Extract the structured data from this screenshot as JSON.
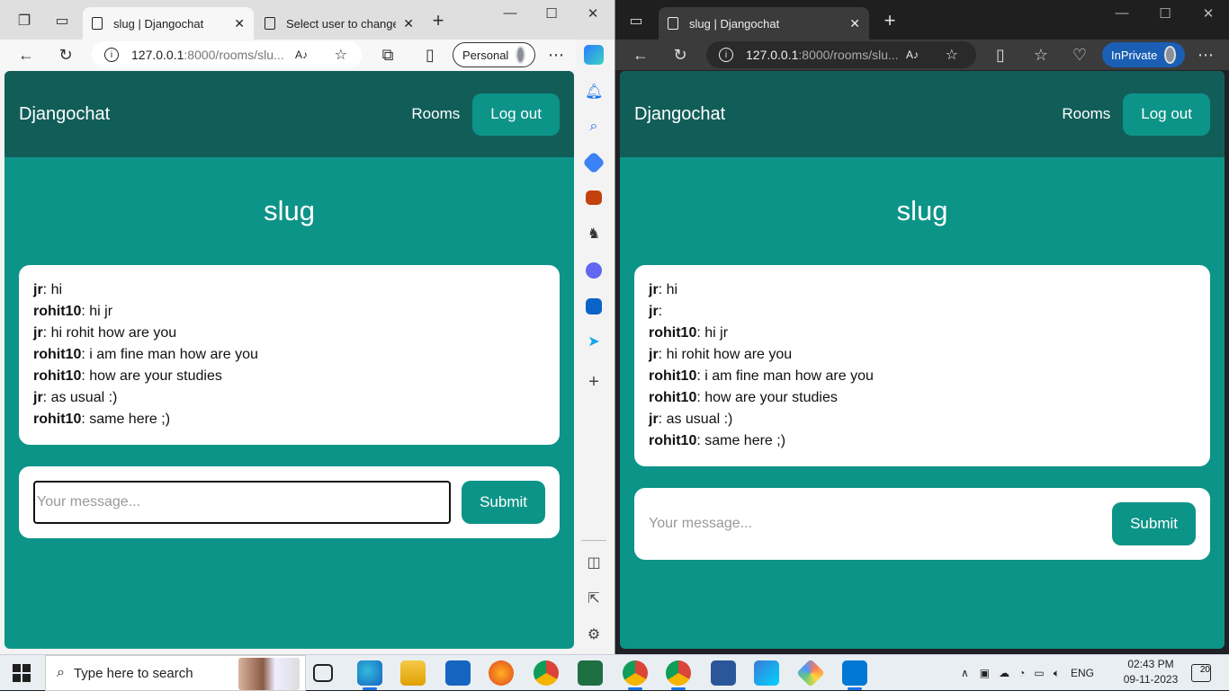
{
  "left_browser": {
    "tabs": [
      {
        "title": "slug | Djangochat",
        "close": "✕"
      },
      {
        "title": "Select user to change | Django site admin",
        "close": "✕"
      }
    ],
    "url_host": "127.0.0.1",
    "url_path": ":8000/rooms/slu...",
    "profile_label": "Personal"
  },
  "right_browser": {
    "tabs": [
      {
        "title": "slug | Djangochat",
        "close": "✕"
      }
    ],
    "url_host": "127.0.0.1",
    "url_path": ":8000/rooms/slu...",
    "profile_label": "InPrivate"
  },
  "left_app": {
    "brand": "Djangochat",
    "nav_rooms": "Rooms",
    "nav_logout": "Log out",
    "room_name": "slug",
    "messages": [
      {
        "user": "jr",
        "text": ": hi"
      },
      {
        "user": "rohit10",
        "text": ": hi jr"
      },
      {
        "user": "jr",
        "text": ": hi rohit how are you"
      },
      {
        "user": "rohit10",
        "text": ": i am fine man how are you"
      },
      {
        "user": "rohit10",
        "text": ": how are your studies"
      },
      {
        "user": "jr",
        "text": ": as usual :)"
      },
      {
        "user": "rohit10",
        "text": ": same here ;)"
      }
    ],
    "input_placeholder": "Your message...",
    "submit_label": "Submit"
  },
  "right_app": {
    "brand": "Djangochat",
    "nav_rooms": "Rooms",
    "nav_logout": "Log out",
    "room_name": "slug",
    "messages": [
      {
        "user": "jr",
        "text": ": hi"
      },
      {
        "user": "jr",
        "text": ":"
      },
      {
        "user": "rohit10",
        "text": ": hi jr"
      },
      {
        "user": "jr",
        "text": ": hi rohit how are you"
      },
      {
        "user": "rohit10",
        "text": ": i am fine man how are you"
      },
      {
        "user": "rohit10",
        "text": ": how are your studies"
      },
      {
        "user": "jr",
        "text": ": as usual :)"
      },
      {
        "user": "rohit10",
        "text": ": same here ;)"
      }
    ],
    "input_placeholder": "Your message...",
    "submit_label": "Submit"
  },
  "taskbar": {
    "search_placeholder": "Type here to search",
    "language": "ENG",
    "time": "02:43 PM",
    "date": "09-11-2023",
    "notification_count": "20"
  },
  "colors": {
    "accent": "#0d9488",
    "nav_dark": "#115e59"
  }
}
